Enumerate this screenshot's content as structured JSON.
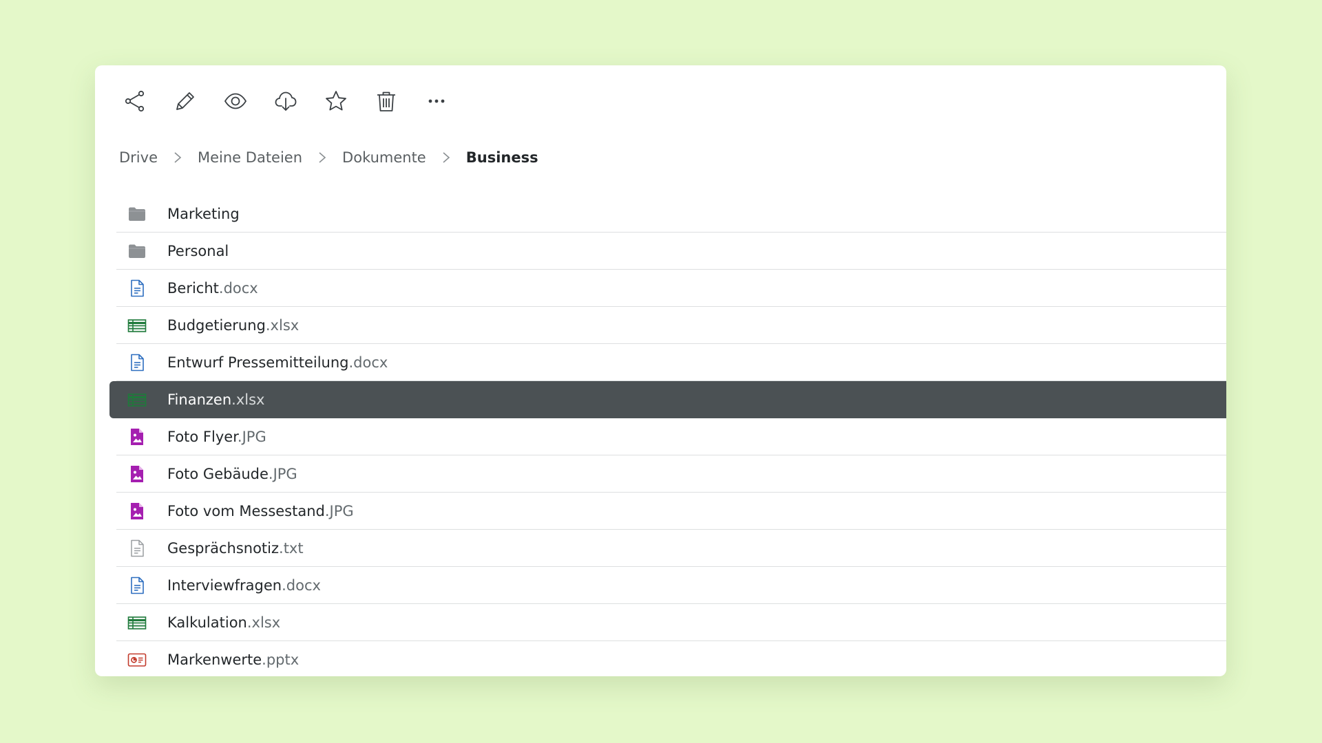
{
  "colors": {
    "background": "#e4f8c9",
    "selected_row": "#4b5154",
    "folder": "#8d9194",
    "document": "#2d6ec0",
    "spreadsheet": "#1f7a3b",
    "image": "#a51fb0",
    "text_file": "#9a9ea1",
    "presentation": "#c23a2b"
  },
  "toolbar": {
    "actions": [
      {
        "name": "share",
        "icon": "share-icon"
      },
      {
        "name": "edit",
        "icon": "pencil-icon"
      },
      {
        "name": "preview",
        "icon": "eye-icon"
      },
      {
        "name": "download",
        "icon": "cloud-download-icon"
      },
      {
        "name": "favorite",
        "icon": "star-icon"
      },
      {
        "name": "delete",
        "icon": "trash-icon"
      },
      {
        "name": "more",
        "icon": "more-icon"
      }
    ]
  },
  "breadcrumb": {
    "items": [
      "Drive",
      "Meine Dateien",
      "Dokumente",
      "Business"
    ]
  },
  "files": [
    {
      "base": "Marketing",
      "ext": "",
      "type": "folder",
      "selected": false
    },
    {
      "base": "Personal",
      "ext": "",
      "type": "folder",
      "selected": false
    },
    {
      "base": "Bericht",
      "ext": ".docx",
      "type": "document",
      "selected": false
    },
    {
      "base": "Budgetierung",
      "ext": ".xlsx",
      "type": "spreadsheet",
      "selected": false
    },
    {
      "base": "Entwurf Pressemitteilung",
      "ext": ".docx",
      "type": "document",
      "selected": false
    },
    {
      "base": "Finanzen",
      "ext": ".xlsx",
      "type": "spreadsheet",
      "selected": true
    },
    {
      "base": "Foto Flyer",
      "ext": ".JPG",
      "type": "image",
      "selected": false
    },
    {
      "base": "Foto Gebäude",
      "ext": ".JPG",
      "type": "image",
      "selected": false
    },
    {
      "base": "Foto vom Messestand",
      "ext": ".JPG",
      "type": "image",
      "selected": false
    },
    {
      "base": "Gesprächsnotiz",
      "ext": ".txt",
      "type": "text_file",
      "selected": false
    },
    {
      "base": "Interviewfragen",
      "ext": ".docx",
      "type": "document",
      "selected": false
    },
    {
      "base": "Kalkulation",
      "ext": ".xlsx",
      "type": "spreadsheet",
      "selected": false
    },
    {
      "base": "Markenwerte",
      "ext": ".pptx",
      "type": "presentation",
      "selected": false
    }
  ]
}
